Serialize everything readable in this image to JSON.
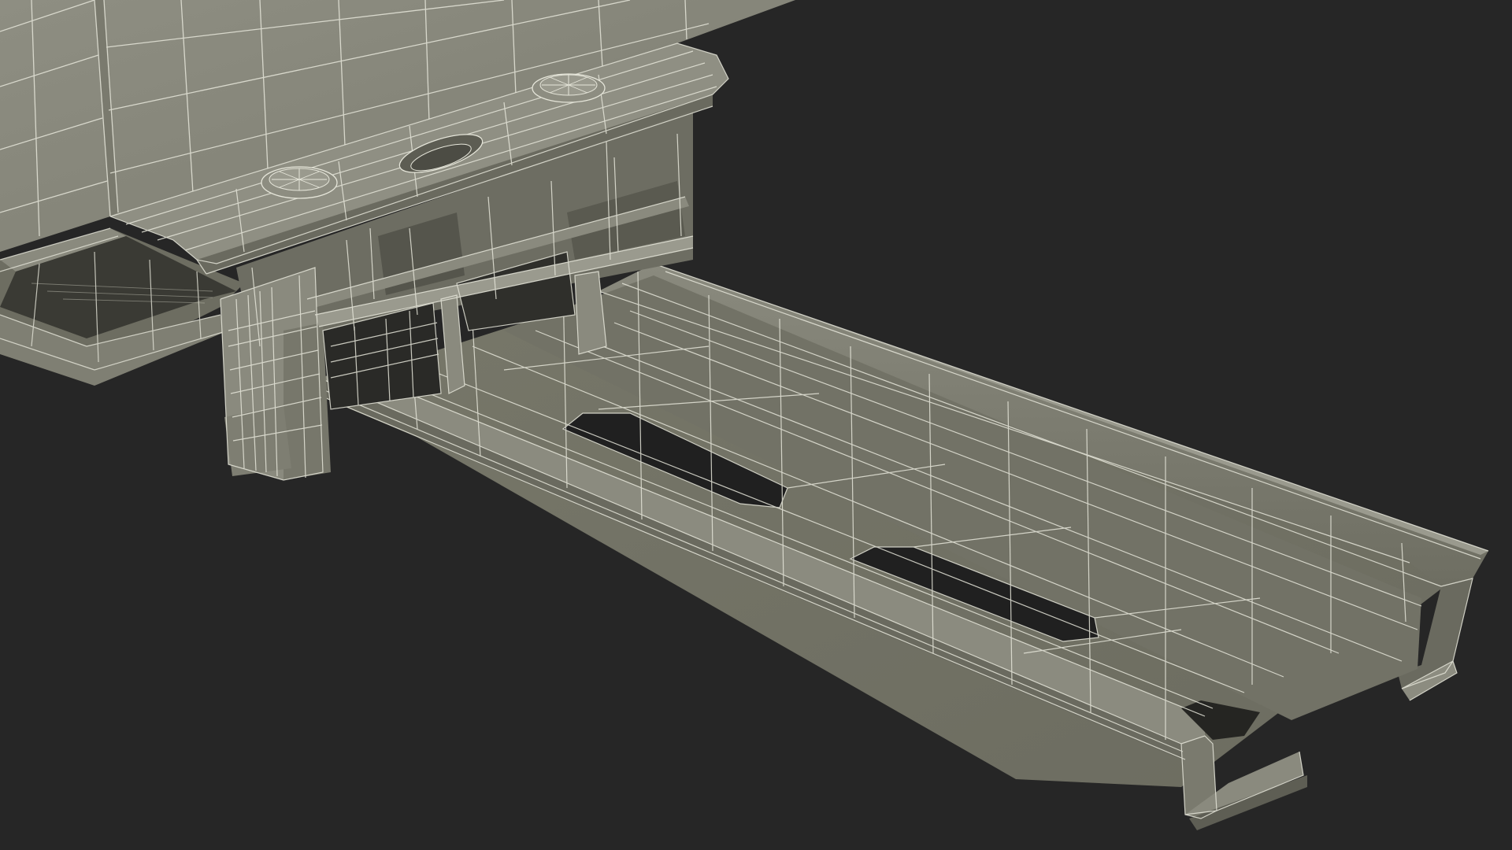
{
  "colors": {
    "background": "#262626",
    "surface_light": "#8c8c80",
    "surface_mid": "#77776b",
    "surface_dark": "#5f5f55",
    "surface_shadow": "#48483f",
    "cavity": "#232323",
    "wire": "#e8e8dc"
  },
  "subject": {
    "view": "wireframe-render",
    "parts": [
      "back-panel",
      "mounting-bracket",
      "screw-head-left",
      "screw-head-right",
      "slide-rail-outer",
      "slide-rail-inner",
      "rail-slot"
    ]
  }
}
